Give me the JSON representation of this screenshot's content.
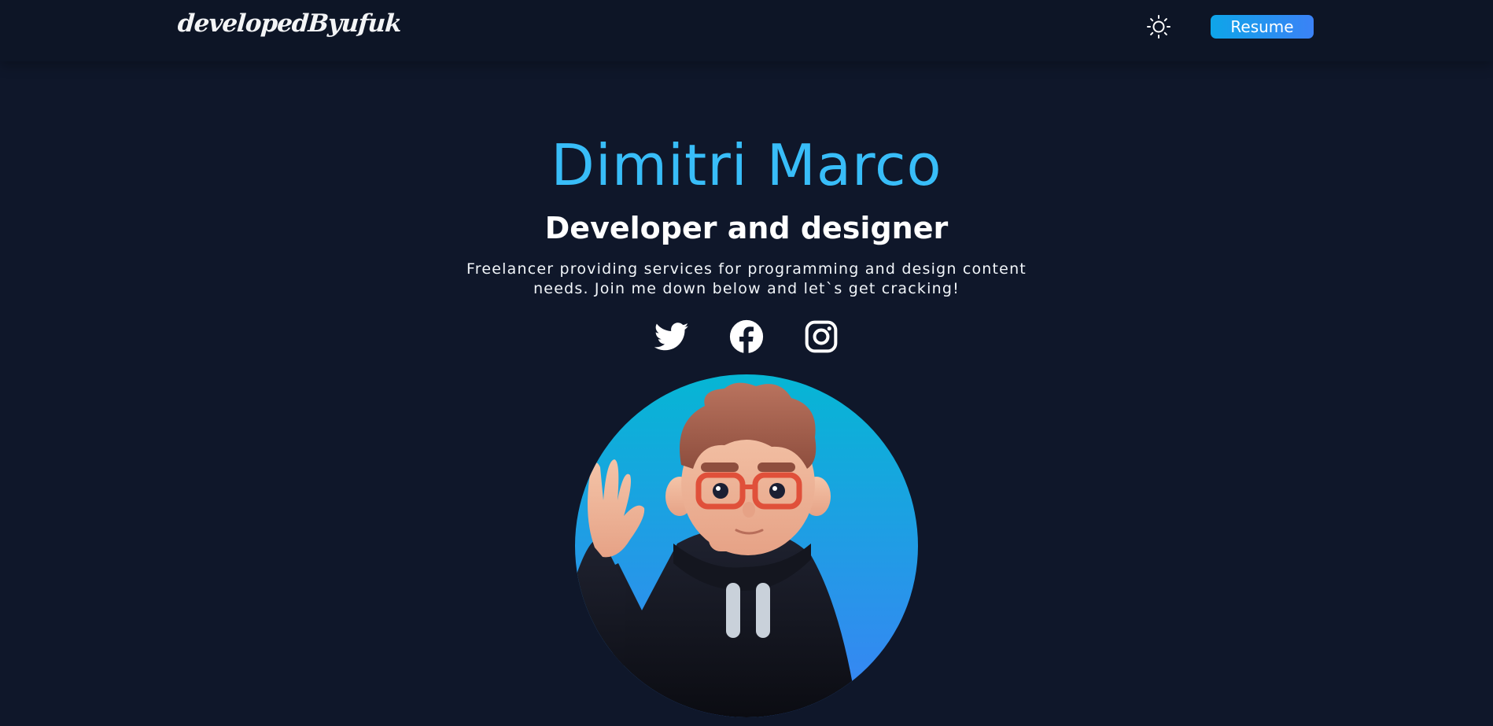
{
  "header": {
    "logo_text": "developedByufuk",
    "theme_icon": "sun-icon",
    "resume_label": "Resume"
  },
  "hero": {
    "name": "Dimitri Marco",
    "role": "Developer and designer",
    "description": "Freelancer providing services for programming and design content needs. Join me down below and let`s get cracking!"
  },
  "social": [
    {
      "icon": "twitter-icon"
    },
    {
      "icon": "facebook-icon"
    },
    {
      "icon": "instagram-icon"
    }
  ],
  "colors": {
    "background": "#0f172a",
    "accent": "#38bdf8",
    "button_gradient_start": "#0ea5e9",
    "button_gradient_end": "#3b82f6"
  }
}
